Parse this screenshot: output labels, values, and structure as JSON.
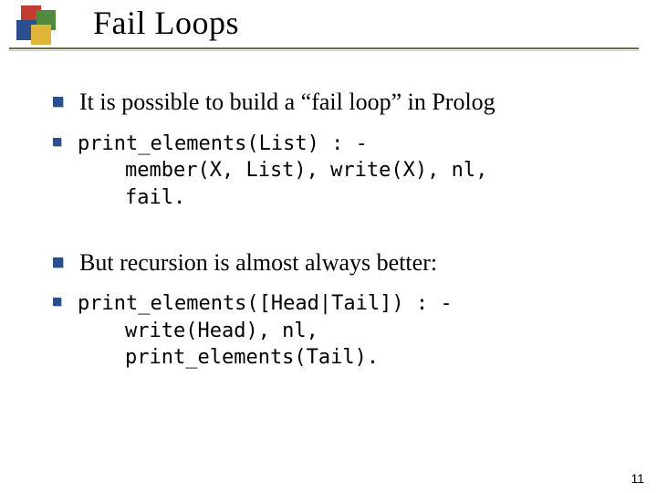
{
  "slide": {
    "title": "Fail Loops",
    "page_number": "11"
  },
  "bullets": {
    "b1": "It is possible to build a “fail loop” in Prolog",
    "b2_line1": "print_elements(List) : -",
    "b2_line2": "member(X, List), write(X), nl,",
    "b2_line3": "fail.",
    "b3": "But recursion is almost always better:",
    "b4_line1": "print_elements([Head|Tail]) : -",
    "b4_line2": "write(Head), nl,",
    "b4_line3": "print_elements(Tail)."
  }
}
